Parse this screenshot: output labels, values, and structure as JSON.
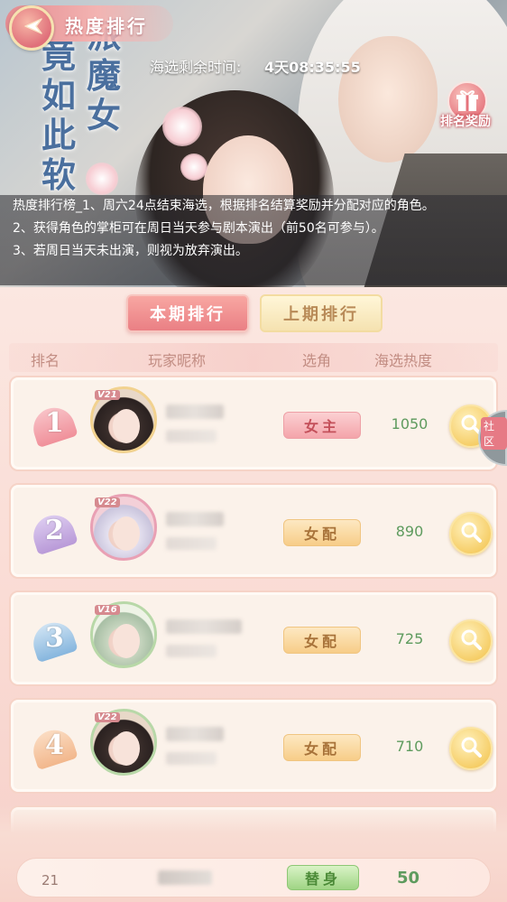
{
  "header": {
    "title": "热度排行",
    "calligraphy_left": "竟如此软",
    "calligraphy_right": "派魔女",
    "timer_label": "海选剩余时间:",
    "timer_value": "4天08:35:55",
    "reward_label": "排名奖励"
  },
  "rules": [
    "热度排行榜_1、周六24点结束海选，根据排名结算奖励并分配对应的角色。",
    "2、获得角色的掌柜可在周日当天参与剧本演出（前50名可参与）。",
    "3、若周日当天未出演，则视为放弃演出。"
  ],
  "tabs": {
    "current": "本期排行",
    "previous": "上期排行"
  },
  "columns": {
    "rank": "排名",
    "nickname": "玩家昵称",
    "role": "选角",
    "heat": "海选热度"
  },
  "rows": [
    {
      "rank": "1",
      "vip": "V21",
      "role": "女主",
      "heat": "1050"
    },
    {
      "rank": "2",
      "vip": "V22",
      "role": "女配",
      "heat": "890"
    },
    {
      "rank": "3",
      "vip": "V16",
      "role": "女配",
      "heat": "725"
    },
    {
      "rank": "4",
      "vip": "V22",
      "role": "女配",
      "heat": "710"
    }
  ],
  "side_tab": "社区",
  "my_entry": {
    "rank": "21",
    "role": "替身",
    "heat": "50"
  },
  "colors": {
    "rank1": "#f0909a",
    "rank2": "#b99ad8",
    "rank3": "#86b6de",
    "rank4": "#f2b78c"
  },
  "icons": {
    "back": "back-arrow-icon",
    "reward": "gift-icon",
    "view": "magnifier-icon"
  }
}
